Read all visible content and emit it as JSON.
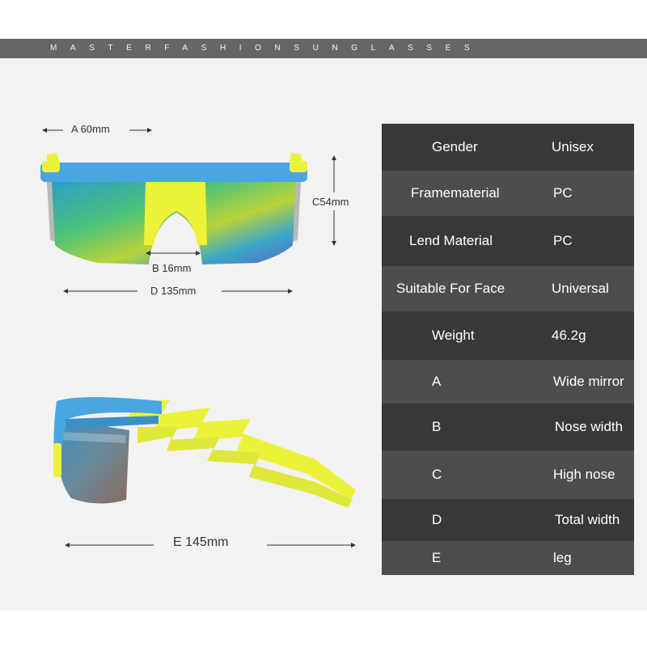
{
  "banner": {
    "text": "MASTERFASHIONSUNGLASSES"
  },
  "front_view": {
    "width_label": "A 60mm",
    "height_label": "C54mm",
    "nose_label": "B 16mm",
    "total_label": "D 135mm"
  },
  "side_view": {
    "leg_label": "E 145mm"
  },
  "specs": [
    {
      "key": "Gender",
      "value": "Unisex"
    },
    {
      "key": "Framematerial",
      "value": "PC"
    },
    {
      "key": "Lend Material",
      "value": "PC"
    },
    {
      "key": "Suitable For Face",
      "value": "Universal"
    },
    {
      "key": "Weight",
      "value": "46.2g"
    },
    {
      "key": "A",
      "value": "Wide mirror"
    },
    {
      "key": "B",
      "value": "Nose width"
    },
    {
      "key": "C",
      "value": "High nose"
    },
    {
      "key": "D",
      "value": "Total width"
    },
    {
      "key": "E",
      "value": "leg"
    }
  ],
  "colors": {
    "frame_blue": "#4aa6e0",
    "frame_yellow": "#ecf23a",
    "banner_gray": "#666666",
    "table_row_light": "#4d4d4d",
    "table_row_dark": "#383838"
  }
}
